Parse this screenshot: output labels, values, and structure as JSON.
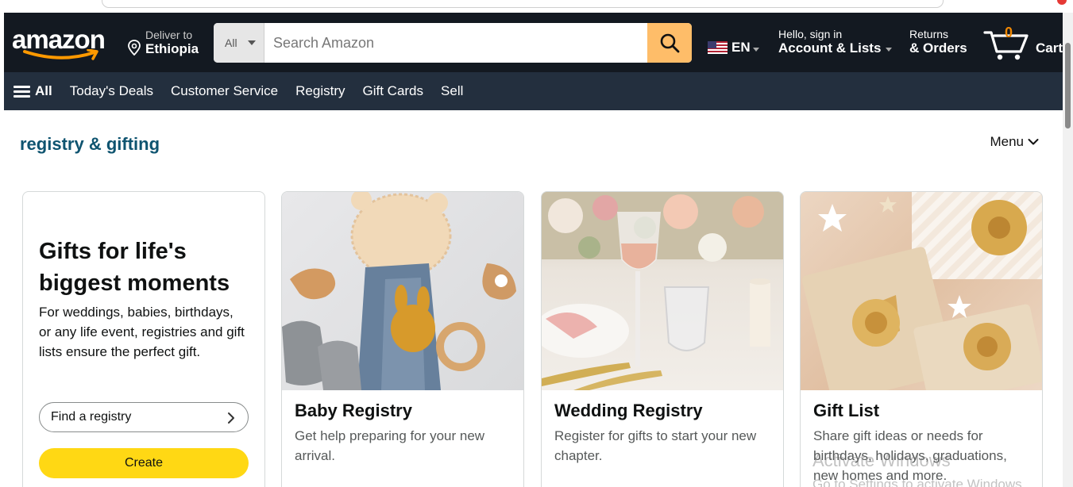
{
  "header": {
    "logo_text": "amazon",
    "deliver_line1": "Deliver to",
    "deliver_line2": "Ethiopia",
    "search_dept": "All",
    "search_placeholder": "Search Amazon",
    "lang_code": "EN",
    "account_line1": "Hello, sign in",
    "account_line2": "Account & Lists",
    "orders_line1": "Returns",
    "orders_line2": "& Orders",
    "cart_count": "0",
    "cart_label": "Cart"
  },
  "subnav": {
    "all_label": "All",
    "links": [
      "Today's Deals",
      "Customer Service",
      "Registry",
      "Gift Cards",
      "Sell"
    ]
  },
  "page": {
    "section_title": "registry & gifting",
    "menu_label": "Menu"
  },
  "intro": {
    "heading": "Gifts for life's biggest moments",
    "text": "For weddings, babies, birthdays, or any life event, registries and gift lists ensure the perfect gift.",
    "find_label": "Find a registry",
    "create_label": "Create"
  },
  "cards": [
    {
      "title": "Baby Registry",
      "text": "Get help preparing for your new arrival."
    },
    {
      "title": "Wedding Registry",
      "text": "Register for gifts to start your new chapter."
    },
    {
      "title": "Gift List",
      "text": "Share gift ideas or needs for birthdays, holidays, graduations, new homes and more."
    }
  ],
  "overlay": {
    "watermark_line1": "Activate Windows",
    "watermark_line2": "Go to Settings to activate Windows."
  },
  "colors": {
    "nav_top": "#131921",
    "nav_sub": "#232f3e",
    "search_button": "#febd69",
    "create_button": "#ffd814",
    "section_title": "#0f5470",
    "cart_count": "#f08804"
  }
}
